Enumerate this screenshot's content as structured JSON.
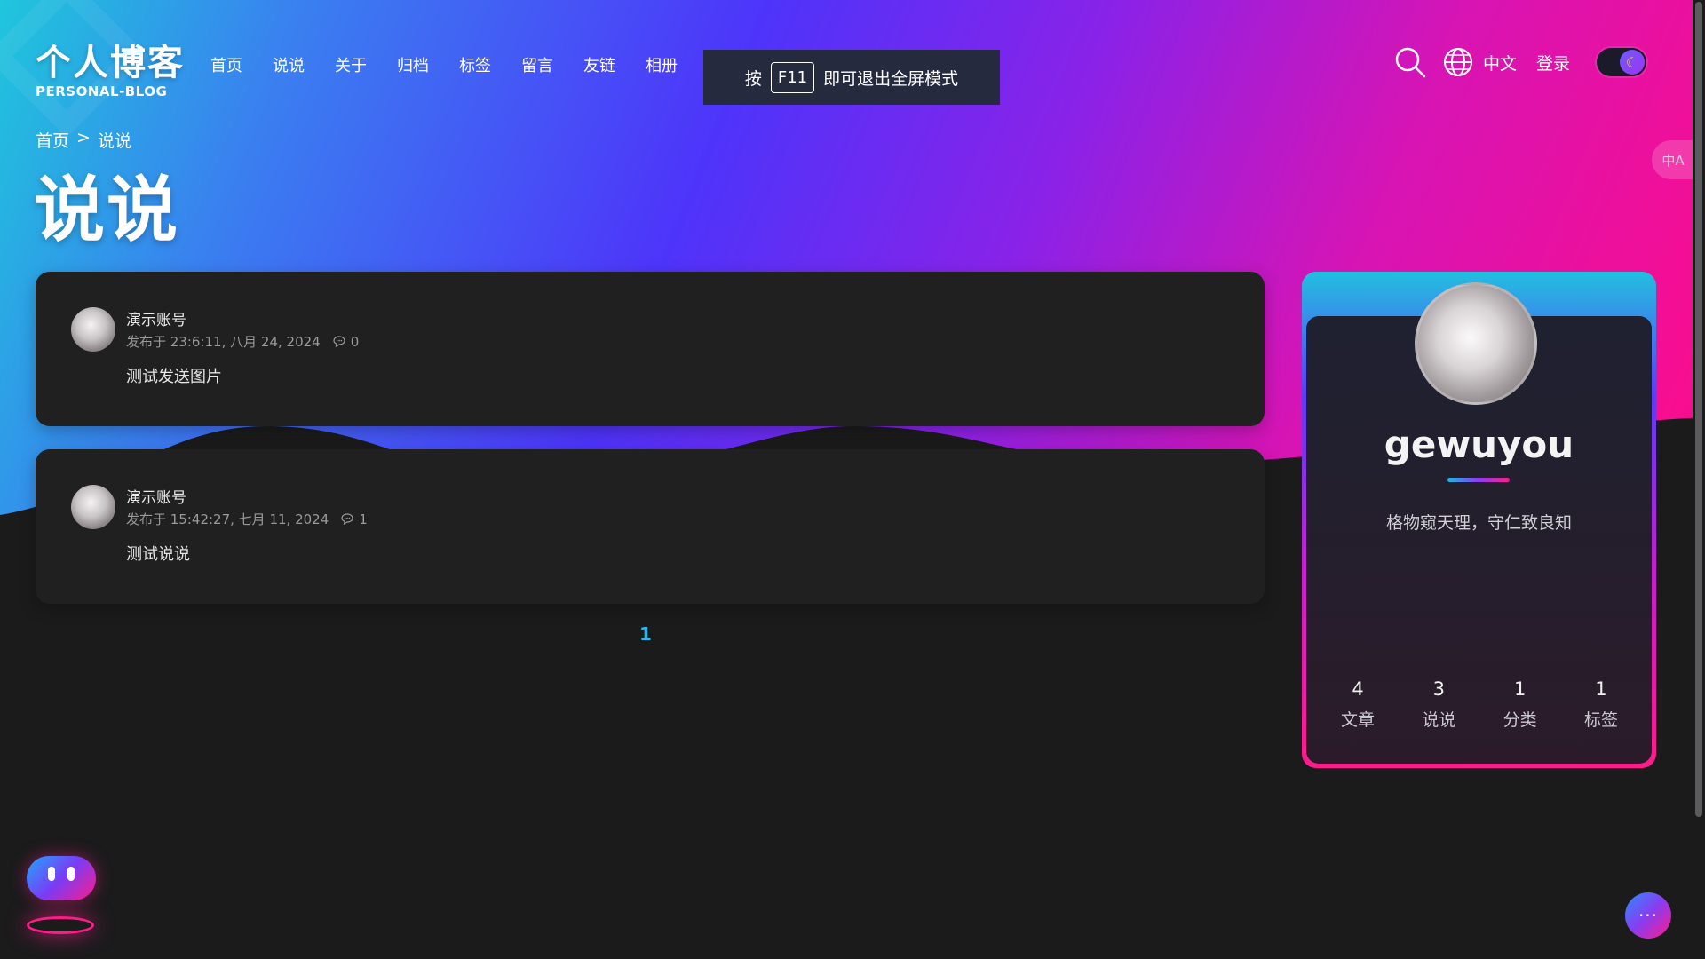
{
  "header": {
    "logo_zh": "个人博客",
    "logo_en": "PERSONAL-BLOG",
    "nav": [
      "首页",
      "说说",
      "关于",
      "归档",
      "标签",
      "留言",
      "友链",
      "相册"
    ],
    "lang_label": "中文",
    "login_label": "登录",
    "theme_toggle_icon": "moon-icon"
  },
  "fullscreen_tip": {
    "prefix": "按",
    "key": "F11",
    "suffix": "即可退出全屏模式"
  },
  "breadcrumb": {
    "home": "首页",
    "sep": ">",
    "current": "说说"
  },
  "page_title": "说说",
  "posts": [
    {
      "author": "演示账号",
      "meta": "发布于 23:6:11, 八月 24, 2024",
      "comments": "0",
      "content": "测试发送图片"
    },
    {
      "author": "演示账号",
      "meta": "发布于 15:42:27, 七月 11, 2024",
      "comments": "1",
      "content": "测试说说"
    }
  ],
  "pagination": {
    "current_page": "1"
  },
  "profile": {
    "name": "gewuyou",
    "motto": "格物窥天理，守仁致良知",
    "stats": [
      {
        "value": "4",
        "label": "文章"
      },
      {
        "value": "3",
        "label": "说说"
      },
      {
        "value": "1",
        "label": "分类"
      },
      {
        "value": "1",
        "label": "标签"
      }
    ]
  },
  "translate_tab": {
    "label": "中A"
  },
  "fab": {
    "label": "···"
  },
  "colors": {
    "accent_cyan": "#1fc6dc",
    "accent_violet": "#4e34fa",
    "accent_pink": "#ff0c88",
    "page_bg": "#1b1b1c",
    "card_bg": "#202021",
    "pager_active": "#2fb6e8"
  }
}
